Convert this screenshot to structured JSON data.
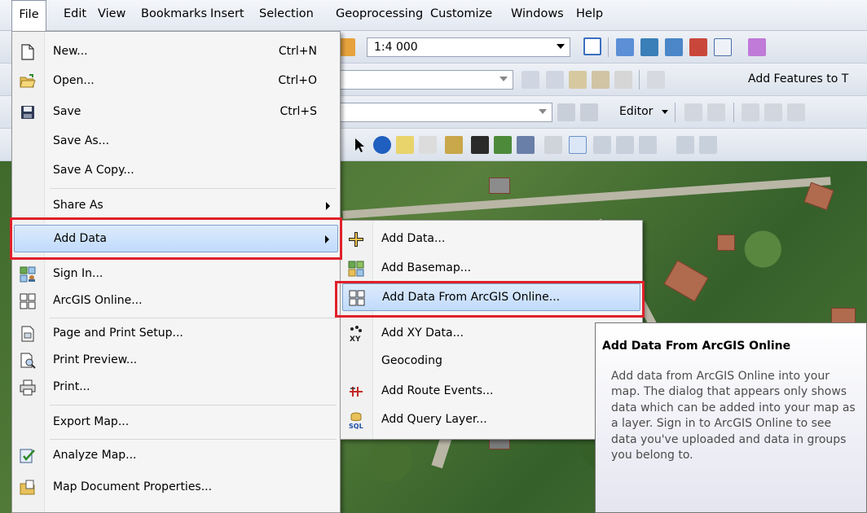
{
  "menubar": {
    "items": [
      "File",
      "Edit",
      "View",
      "Bookmarks",
      "Insert",
      "Selection",
      "Geoprocessing",
      "Customize",
      "Windows",
      "Help"
    ]
  },
  "toolbar": {
    "scale": "1:4 000",
    "add_features_label": "Add Features to T",
    "editor_label": "Editor"
  },
  "file_menu": {
    "items": [
      {
        "label": "New...",
        "shortcut": "Ctrl+N",
        "icon": "new-document-icon"
      },
      {
        "label": "Open...",
        "shortcut": "Ctrl+O",
        "icon": "open-folder-icon"
      },
      {
        "label": "Save",
        "shortcut": "Ctrl+S",
        "icon": "save-disk-icon"
      },
      {
        "label": "Save As...",
        "shortcut": "",
        "icon": ""
      },
      {
        "label": "Save A Copy...",
        "shortcut": "",
        "icon": ""
      },
      {
        "label": "Share As",
        "shortcut": "",
        "icon": "",
        "submenu": true
      },
      {
        "label": "Add Data",
        "shortcut": "",
        "icon": "",
        "submenu": true,
        "highlighted": true
      },
      {
        "label": "Sign In...",
        "shortcut": "",
        "icon": "sign-in-icon"
      },
      {
        "label": "ArcGIS Online...",
        "shortcut": "",
        "icon": "arcgis-online-grid-icon"
      },
      {
        "label": "Page and Print Setup...",
        "shortcut": "",
        "icon": "page-setup-icon"
      },
      {
        "label": "Print Preview...",
        "shortcut": "",
        "icon": "print-preview-icon"
      },
      {
        "label": "Print...",
        "shortcut": "",
        "icon": "printer-icon"
      },
      {
        "label": "Export Map...",
        "shortcut": "",
        "icon": ""
      },
      {
        "label": "Analyze Map...",
        "shortcut": "",
        "icon": "analyze-map-icon"
      },
      {
        "label": "Map Document Properties...",
        "shortcut": "",
        "icon": "document-properties-icon"
      }
    ]
  },
  "add_data_submenu": {
    "items": [
      {
        "label": "Add Data...",
        "icon": "add-data-plus-icon"
      },
      {
        "label": "Add Basemap...",
        "icon": "basemap-icon"
      },
      {
        "label": "Add Data From ArcGIS Online...",
        "icon": "arcgis-online-grid-icon",
        "highlighted": true
      },
      {
        "label": "Add XY Data...",
        "icon": "xy-data-icon"
      },
      {
        "label": "Geocoding",
        "icon": ""
      },
      {
        "label": "Add Route Events...",
        "icon": "route-events-icon"
      },
      {
        "label": "Add Query Layer...",
        "icon": "sql-query-icon"
      }
    ]
  },
  "tooltip": {
    "title": "Add Data From ArcGIS Online",
    "body": "Add data from ArcGIS Online into your map. The dialog that appears only shows data which can be added into your map as a layer. Sign in to ArcGIS Online to see data you've uploaded and data in groups you belong to."
  },
  "colors": {
    "highlight_outline": "#e0202a",
    "menu_highlight": "#c1dbfc"
  }
}
